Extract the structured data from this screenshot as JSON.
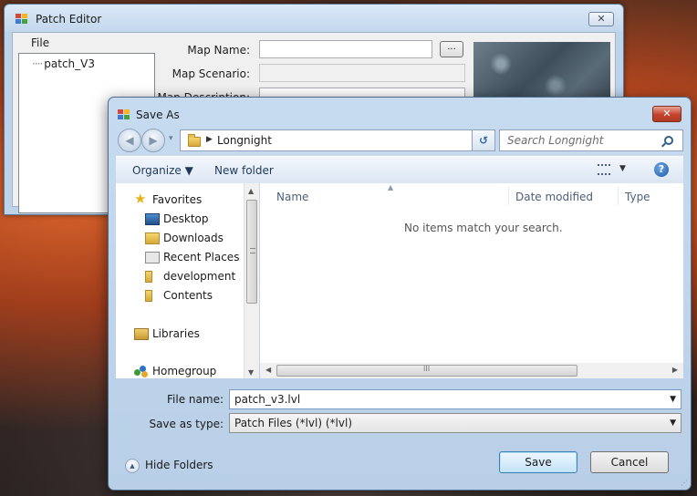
{
  "patch_editor": {
    "title": "Patch Editor",
    "close_glyph": "✕",
    "menu": {
      "file": "File"
    },
    "tree": {
      "items": [
        {
          "label": "patch_V3"
        }
      ]
    },
    "fields": {
      "map_name_label": "Map Name:",
      "map_scenario_label": "Map Scenario:",
      "map_description_label": "Map Description:",
      "browse_label": "..."
    }
  },
  "save_as": {
    "title": "Save As",
    "close_glyph": "✕",
    "nav": {
      "back": "◀",
      "forward": "▶",
      "history": "▾"
    },
    "address": {
      "separator": "▶",
      "path": "Longnight",
      "drop": "▼"
    },
    "refresh_glyph": "↺",
    "search": {
      "placeholder": "Search Longnight"
    },
    "toolbar": {
      "organize": "Organize ▼",
      "new_folder": "New folder",
      "views_drop": "▼",
      "help": "?"
    },
    "nav_pane": {
      "favorites": "Favorites",
      "favorites_items": [
        {
          "label": "Desktop"
        },
        {
          "label": "Downloads"
        },
        {
          "label": "Recent Places"
        },
        {
          "label": "development"
        },
        {
          "label": "Contents"
        }
      ],
      "libraries": "Libraries",
      "homegroup": "Homegroup"
    },
    "list": {
      "columns": [
        {
          "label": "Name"
        },
        {
          "label": "Date modified"
        },
        {
          "label": "Type"
        }
      ],
      "sort_glyph": "▲",
      "empty_message": "No items match your search."
    },
    "scroll": {
      "up": "▲",
      "down": "▼",
      "left": "◀",
      "right": "▶",
      "grip": "III"
    },
    "form": {
      "file_name_label": "File name:",
      "file_name_value": "patch_v3.lvl",
      "save_type_label": "Save as type:",
      "save_type_value": "Patch Files (*lvl) (*lvl)",
      "drop": "▼"
    },
    "hide_folders": {
      "label": "Hide Folders",
      "glyph": "▲"
    },
    "buttons": {
      "save": "Save",
      "cancel": "Cancel"
    },
    "grip": "⋰"
  },
  "colors": {
    "accent": "#3c7fb1",
    "close_red": "#c4432c",
    "folder": "#d7a93b"
  }
}
